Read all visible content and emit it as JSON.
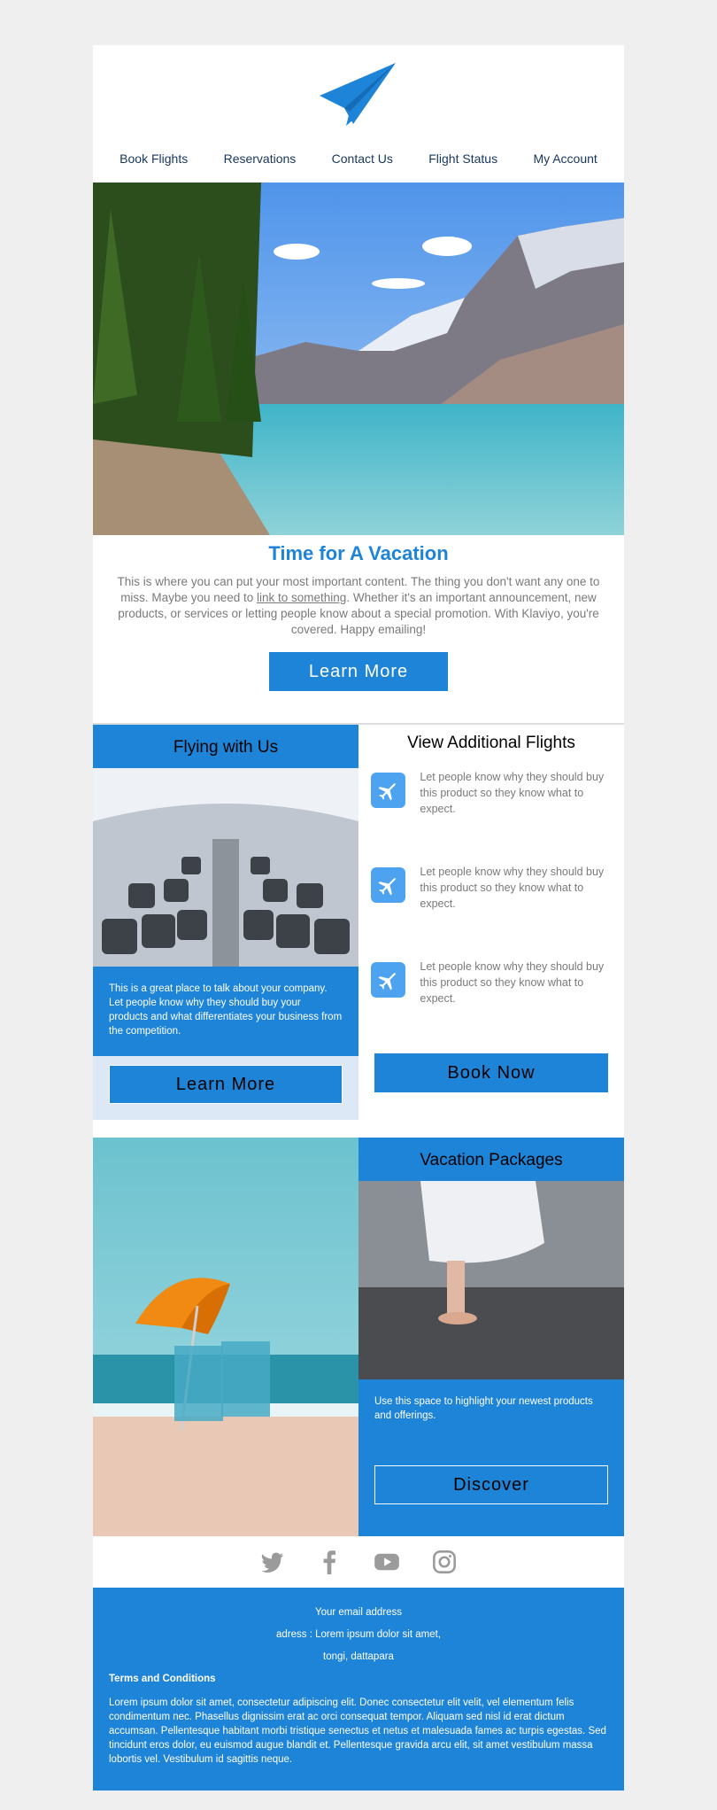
{
  "nav": [
    "Book Flights",
    "Reservations",
    "Contact Us",
    "Flight Status",
    "My Account"
  ],
  "hero": {
    "title": "Time for A Vacation",
    "text_before": "This is where you can put your most important content. The thing you don't want any one to miss. Maybe you need to ",
    "link": "link to something",
    "text_after": ". Whether it's an important announcement, new products, or services or letting people know about a special promotion. With Klaviyo, you're covered. Happy emailing!",
    "button": "Learn More"
  },
  "flying": {
    "title": "Flying with Us",
    "text": "This is a great place to talk about your company. Let people know why they should buy your products and what differentiates your business from the competition.",
    "button": "Learn More"
  },
  "additional": {
    "title": "View Additional Flights",
    "items": [
      "Let people know why they should buy this product so they know what to expect.",
      "Let people know why they should buy this product so they know what to expect.",
      "Let people know why they should buy this product so they know what to expect."
    ],
    "button": "Book Now"
  },
  "packages": {
    "title": "Vacation Packages",
    "text": "Use this space to highlight your newest products and offerings.",
    "button": "Discover"
  },
  "social": [
    "twitter-icon",
    "facebook-icon",
    "youtube-icon",
    "instagram-icon"
  ],
  "footer": {
    "email": "Your email address",
    "address1": "adress : Lorem ipsum dolor sit amet,",
    "address2": "tongi, dattapara",
    "terms_title": "Terms and Conditions",
    "terms_text": "Lorem ipsum dolor sit amet, consectetur adipiscing elit. Donec consectetur elit velit, vel elementum felis condimentum nec. Phasellus dignissim erat ac orci consequat tempor. Aliquam sed nisl id erat dictum accumsan. Pellentesque habitant morbi tristique senectus et netus et malesuada fames ac turpis egestas. Sed tincidunt eros dolor, eu euismod augue blandit et. Pellentesque gravida arcu elit, sit amet vestibulum massa lobortis vel. Vestibulum id sagittis neque."
  },
  "colors": {
    "brand": "#1e84d8",
    "background": "#efefef",
    "nav_text": "#17365d"
  }
}
